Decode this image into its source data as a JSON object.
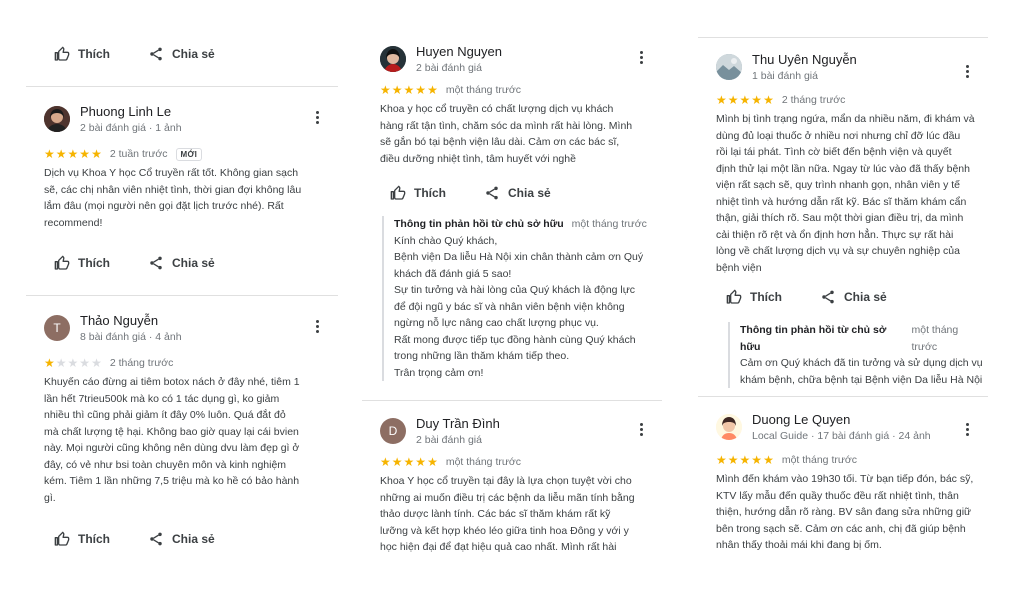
{
  "actions": {
    "like": "Thích",
    "share": "Chia sẻ"
  },
  "col1": {
    "r1": {
      "name": "Phuong Linh Le",
      "meta": "2 bài đánh giá · 1 ảnh",
      "stars": 5,
      "when": "2 tuần trước",
      "badge": "MỚI",
      "lines": [
        "Dịch vụ Khoa Y học Cổ truyền rất tốt. Không gian sạch",
        "sẽ, các chị nhân viên nhiệt tình, thời gian đợi không lâu",
        "lắm đâu (mọi người nên gọi đặt lịch trước nhé). Rất",
        "recommend!"
      ]
    },
    "r2": {
      "name": "Thảo Nguyễn",
      "initial": "T",
      "meta": "8 bài đánh giá · 4 ảnh",
      "stars": 1,
      "when": "2 tháng trước",
      "lines": [
        "Khuyến cáo đừng ai tiêm botox nách ở đây nhé, tiêm 1",
        "lần hết 7trieu500k mà ko có 1 tác dụng gì, ko giảm",
        "nhiều thì cũng phải giảm ít đây 0% luôn. Quá đắt đỏ",
        "mà chất lượng tệ hại. Không bao giờ quay lại cái bvien",
        "này. Mọi người cũng không nên dùng dvu làm đẹp gì ở",
        "đây, có vẻ như bsi toàn chuyên môn và kinh nghiệm",
        "kém. Tiêm 1 lần những 7,5 triệu mà ko hề có bảo hành",
        "gì."
      ]
    }
  },
  "col2": {
    "r1": {
      "name": "Huyen Nguyen",
      "meta": "2 bài đánh giá",
      "stars": 5,
      "when": "một tháng trước",
      "lines": [
        "Khoa y học cổ truyền có chất lượng dịch vụ khách",
        "hàng rất tận tình, chăm sóc da mình rất hài lòng. Mình",
        "sẽ gắn bó tại bệnh viện lâu dài. Cảm ơn các bác sĩ,",
        "điều dưỡng nhiệt tình, tâm huyết với nghề"
      ],
      "owner": {
        "title": "Thông tin phản hồi từ chủ sở hữu",
        "when": "một tháng trước",
        "lines": [
          "Kính chào Quý khách,",
          "Bệnh viện Da liễu Hà Nội xin chân thành cảm ơn Quý",
          "khách đã đánh giá 5 sao!",
          "Sự tin tưởng và hài lòng của Quý khách là động lực",
          "để đội ngũ y bác sĩ và nhân viên bệnh viện không",
          "ngừng nỗ lực nâng cao chất lượng phục vụ.",
          "Rất mong được tiếp tục đồng hành cùng Quý khách",
          "trong những lần thăm khám tiếp theo.",
          "Trân trọng cảm ơn!"
        ]
      }
    },
    "r2": {
      "name": "Duy Trần Đình",
      "initial": "D",
      "meta": "2 bài đánh giá",
      "stars": 5,
      "when": "một tháng trước",
      "lines": [
        "Khoa Y học cổ truyền tại đây là lựa chọn tuyệt vời cho",
        "những ai muốn điều trị các bệnh da liễu mãn tính bằng",
        "thảo dược lành tính. Các bác sĩ thăm khám rất kỹ",
        "lưỡng và kết hợp khéo léo giữa tinh hoa Đông y với y",
        "học hiện đại để đạt hiệu quả cao nhất. Mình rất hài"
      ]
    }
  },
  "col3": {
    "r1": {
      "name": "Thu Uyên Nguyễn",
      "meta": "1 bài đánh giá",
      "stars": 5,
      "when": "2 tháng trước",
      "lines": [
        "Mình bị tình trạng ngứa, mẩn da nhiều năm, đi khám và",
        "dùng đủ loại thuốc ở nhiều nơi nhưng chỉ đỡ lúc đầu",
        "rồi lại tái phát. Tình cờ biết đến bệnh viện và quyết",
        "định thử lại một lần nữa. Ngay từ lúc vào đã thấy bệnh",
        "viện rất sạch sẽ, quy trình nhanh gọn, nhân viên y tế",
        "nhiệt tình và hướng dẫn rất kỹ. Bác sĩ thăm khám cẩn",
        "thận, giải thích rõ. Sau một thời gian điều trị, da mình",
        "cải thiện rõ rệt và ổn định hơn hẳn. Thực sự rất hài",
        "lòng về chất lượng dịch vụ và sự chuyên nghiệp của",
        "bệnh viện"
      ],
      "owner": {
        "title": "Thông tin phản hồi từ chủ sở hữu",
        "when": "một tháng trước",
        "lines": [
          "Cảm ơn Quý khách đã tin tưởng và sử dụng dịch vụ",
          "khám bệnh, chữa bệnh tại Bệnh viện Da liễu Hà Nội"
        ]
      }
    },
    "r2": {
      "name": "Duong Le Quyen",
      "meta": "Local Guide · 17 bài đánh giá · 24 ảnh",
      "stars": 5,
      "when": "một tháng trước",
      "lines": [
        "Mình đến khám vào 19h30 tối. Từ bạn tiếp đón, bác sỹ,",
        "KTV lấy mẫu đến quầy thuốc đều rất nhiệt tình, thân",
        "thiện, hướng dẫn rõ ràng. BV sân đang sửa những giữ",
        "bên trong sạch sẽ. Cảm ơn các anh, chị đã giúp bệnh",
        "nhân thấy thoải mái khi đang bị ốm."
      ]
    }
  },
  "colors": {
    "star": "#f6b400",
    "star_off": "#dadce0",
    "avatar_t": "#8d6e63",
    "avatar_d": "#8d6e63"
  }
}
